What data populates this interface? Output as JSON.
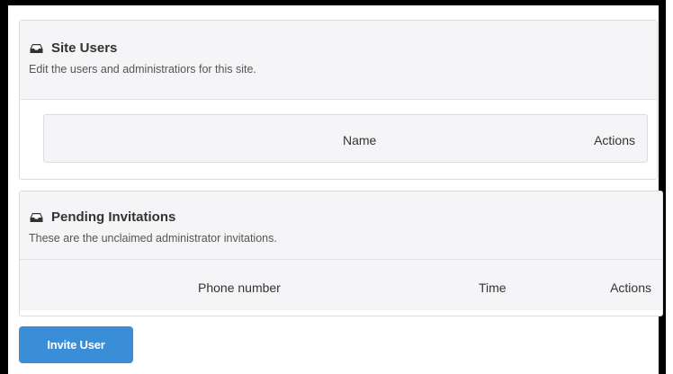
{
  "site_users": {
    "icon": "inbox-tray-icon",
    "title": "Site Users",
    "description": "Edit the users and administratiors for this site.",
    "table": {
      "columns": [
        "Name",
        "Actions"
      ],
      "rows": []
    }
  },
  "pending_invitations": {
    "icon": "inbox-tray-icon",
    "title": "Pending Invitations",
    "description": "These are the unclaimed administrator invitations.",
    "table": {
      "columns": [
        "Phone number",
        "Time",
        "Actions"
      ],
      "rows": []
    }
  },
  "invite_button": {
    "label": "Invite User",
    "color": "#3a8ed8"
  }
}
